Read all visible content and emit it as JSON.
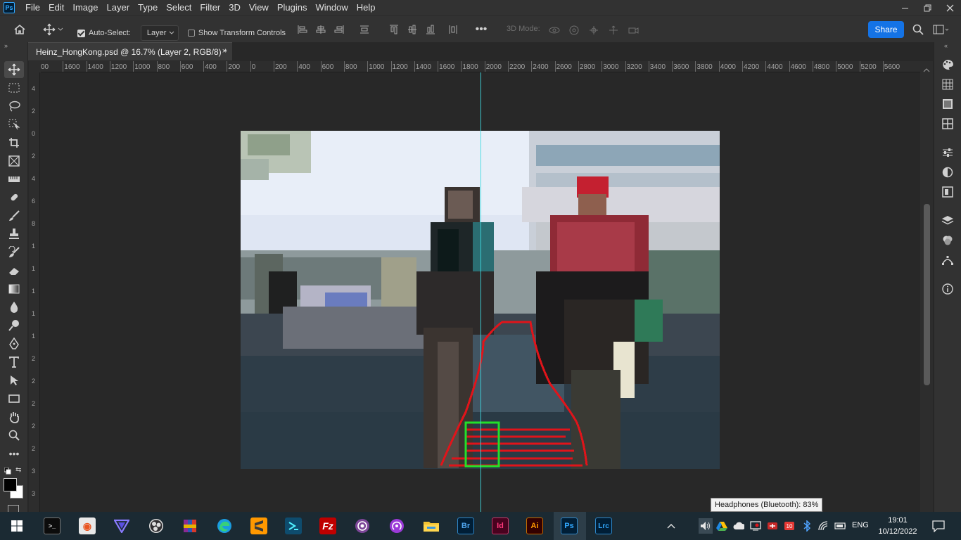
{
  "app": {
    "logo": "Ps",
    "menus": [
      "File",
      "Edit",
      "Image",
      "Layer",
      "Type",
      "Select",
      "Filter",
      "3D",
      "View",
      "Plugins",
      "Window",
      "Help"
    ]
  },
  "options": {
    "auto_select_label": "Auto-Select:",
    "auto_select_checked": true,
    "layer_dropdown_value": "Layer",
    "show_transform_label": "Show Transform Controls",
    "show_transform_checked": false,
    "mode_3d_label": "3D Mode:",
    "share_label": "Share"
  },
  "document": {
    "tab_title": "Heinz_HongKong.psd @ 16.7% (Layer 2, RGB/8) *",
    "close_glyph": "×"
  },
  "rulers": {
    "top_labels": [
      "00",
      "1600",
      "1400",
      "1200",
      "1000",
      "800",
      "600",
      "400",
      "200",
      "0",
      "200",
      "400",
      "600",
      "800",
      "1000",
      "1200",
      "1400",
      "1600",
      "1800",
      "2000",
      "2200",
      "2400",
      "2600",
      "2800",
      "3000",
      "3200",
      "3400",
      "3600",
      "3800",
      "4000",
      "4200",
      "4400",
      "4600",
      "4800",
      "5000",
      "5200",
      "5600"
    ],
    "left_labels": [
      "4",
      "2",
      "0",
      "2",
      "4",
      "6",
      "8",
      "1",
      "1",
      "1",
      "1",
      "1",
      "2",
      "2",
      "2",
      "2",
      "2",
      "3",
      "3"
    ]
  },
  "tooltip": {
    "text": "Headphones (Bluetooth): 83%"
  },
  "taskbar": {
    "language": "ENG",
    "time": "19:01",
    "date": "10/12/2022",
    "apps": [
      "terminal",
      "ubuntu",
      "vpn",
      "obs",
      "winrar",
      "edge",
      "sublime-text",
      "powershell",
      "filezilla",
      "tor",
      "podcast",
      "file-explorer",
      "bridge",
      "indesign",
      "illustrator",
      "photoshop",
      "lightroom-classic"
    ],
    "app_letters": {
      "bridge": "Br",
      "indesign": "Id",
      "illustrator": "Ai",
      "photoshop": "Ps",
      "lightroom": "Lrc"
    },
    "badge_count": "10"
  },
  "colors": {
    "accent_blue": "#1473e6",
    "guide_cyan": "#3fd8e0",
    "annotation_red": "#e0141a",
    "annotation_green": "#22e02a"
  }
}
